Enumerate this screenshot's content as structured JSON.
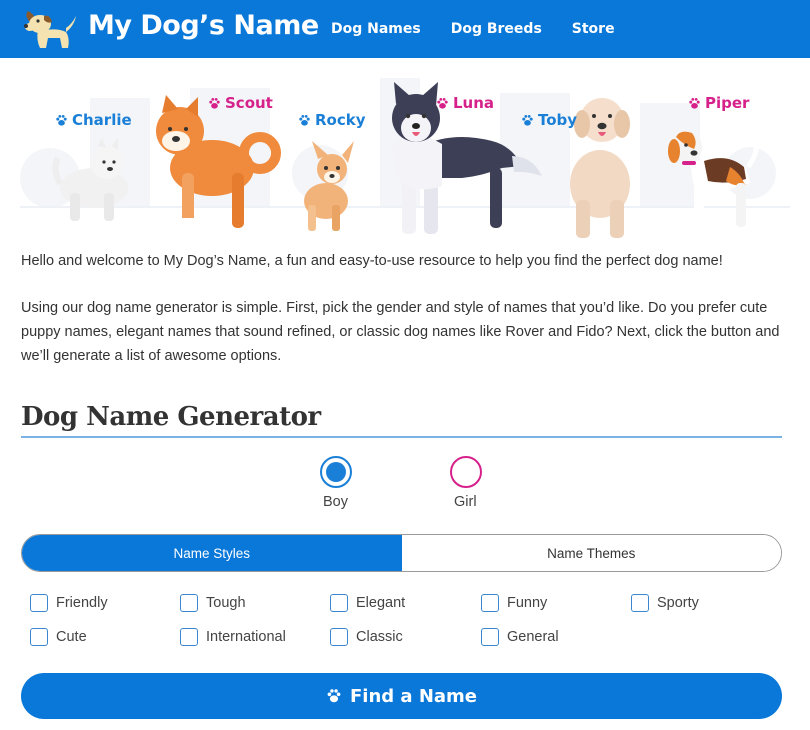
{
  "header": {
    "site_title": "My Dog’s Name",
    "logo_icon": "dog-logo-icon",
    "nav": [
      "Dog Names",
      "Dog Breeds",
      "Store"
    ],
    "background": "#0a78d8"
  },
  "hero": {
    "dogs": [
      {
        "name": "Charlie",
        "gender": "boy"
      },
      {
        "name": "Scout",
        "gender": "girl"
      },
      {
        "name": "Rocky",
        "gender": "boy"
      },
      {
        "name": "Luna",
        "gender": "girl"
      },
      {
        "name": "Toby",
        "gender": "boy"
      },
      {
        "name": "Piper",
        "gender": "girl"
      }
    ],
    "boy_color": "#1a7fd6",
    "girl_color": "#d6208a"
  },
  "intro": {
    "p1": "Hello and welcome to My Dog’s Name, a fun and easy-to-use resource to help you find the perfect dog name!",
    "p2": "Using our dog name generator is simple. First, pick the gender and style of names that you’d like. Do you prefer cute puppy names, elegant names that sound refined, or classic dog names like Rover and Fido? Next, click the button and we’ll generate a list of awesome options."
  },
  "generator": {
    "title": "Dog Name Generator",
    "gender_options": [
      {
        "label": "Boy",
        "selected": true
      },
      {
        "label": "Girl",
        "selected": false
      }
    ],
    "tabs": [
      {
        "label": "Name Styles",
        "active": true
      },
      {
        "label": "Name Themes",
        "active": false
      }
    ],
    "styles": [
      "Friendly",
      "Tough",
      "Elegant",
      "Funny",
      "Sporty",
      "Cute",
      "International",
      "Classic",
      "General"
    ],
    "find_button": "Find a Name",
    "find_icon": "paw-icon"
  }
}
